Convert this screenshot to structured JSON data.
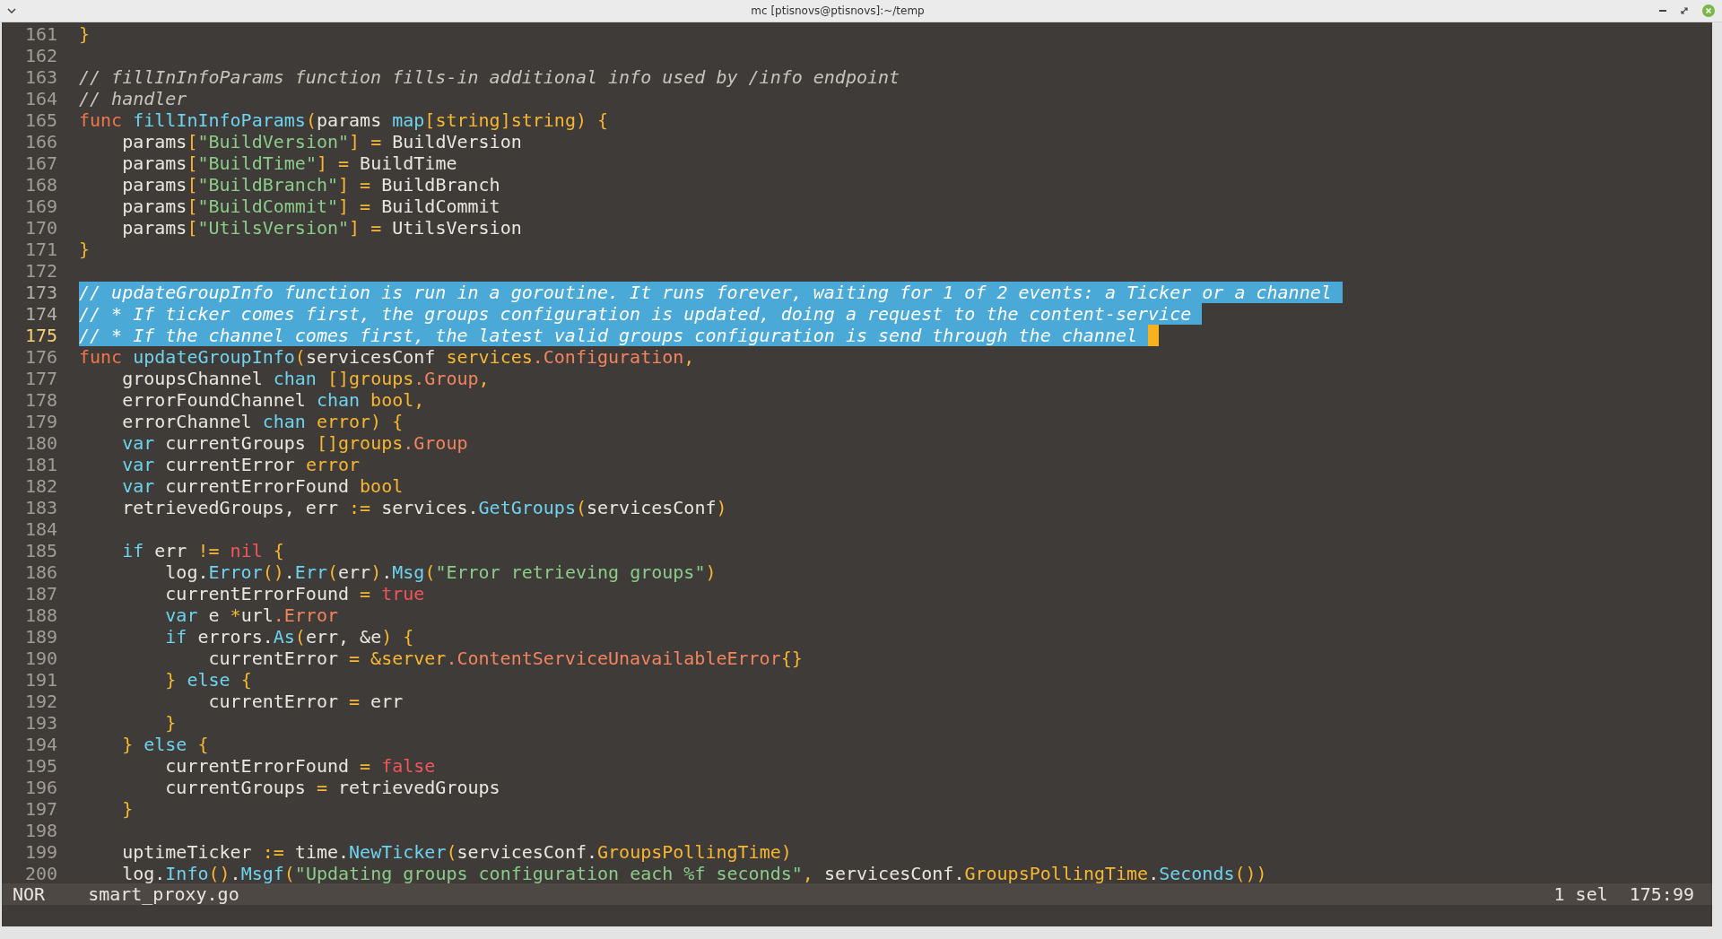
{
  "window": {
    "title": "mc [ptisnovs@ptisnovs]:~/temp"
  },
  "lines": [
    {
      "number": "161",
      "selected": false,
      "current": false,
      "tokens": [
        {
          "text": "}",
          "kind": "y"
        }
      ]
    },
    {
      "number": "162",
      "selected": false,
      "current": false
    },
    {
      "number": "163",
      "selected": false,
      "current": false,
      "tokens": [
        {
          "text": "// fillInInfoParams function fills-in additional info used by /info endpoint",
          "kind": "c"
        }
      ]
    },
    {
      "number": "164",
      "selected": false,
      "current": false,
      "tokens": [
        {
          "text": "// handler",
          "kind": "c"
        }
      ]
    },
    {
      "number": "165",
      "selected": false,
      "current": false,
      "tokens": [
        {
          "text": "func",
          "kind": "k"
        },
        {
          "text": " fillInInfoParams",
          "kind": "b"
        },
        {
          "text": "(",
          "kind": "y"
        },
        {
          "text": "params ",
          "kind": "p"
        },
        {
          "text": "map",
          "kind": "b"
        },
        {
          "text": "[string]string) {",
          "kind": "y"
        }
      ]
    },
    {
      "number": "166",
      "selected": false,
      "current": false,
      "tokens": [
        {
          "text": "    params",
          "kind": "p"
        },
        {
          "text": "[",
          "kind": "y"
        },
        {
          "text": "\"BuildVersion\"",
          "kind": "s"
        },
        {
          "text": "] = ",
          "kind": "y"
        },
        {
          "text": "BuildVersion",
          "kind": "p"
        }
      ]
    },
    {
      "number": "167",
      "selected": false,
      "current": false,
      "tokens": [
        {
          "text": "    params",
          "kind": "p"
        },
        {
          "text": "[",
          "kind": "y"
        },
        {
          "text": "\"BuildTime\"",
          "kind": "s"
        },
        {
          "text": "] = ",
          "kind": "y"
        },
        {
          "text": "BuildTime",
          "kind": "p"
        }
      ]
    },
    {
      "number": "168",
      "selected": false,
      "current": false,
      "tokens": [
        {
          "text": "    params",
          "kind": "p"
        },
        {
          "text": "[",
          "kind": "y"
        },
        {
          "text": "\"BuildBranch\"",
          "kind": "s"
        },
        {
          "text": "] = ",
          "kind": "y"
        },
        {
          "text": "BuildBranch",
          "kind": "p"
        }
      ]
    },
    {
      "number": "169",
      "selected": false,
      "current": false,
      "tokens": [
        {
          "text": "    params",
          "kind": "p"
        },
        {
          "text": "[",
          "kind": "y"
        },
        {
          "text": "\"BuildCommit\"",
          "kind": "s"
        },
        {
          "text": "] = ",
          "kind": "y"
        },
        {
          "text": "BuildCommit",
          "kind": "p"
        }
      ]
    },
    {
      "number": "170",
      "selected": false,
      "current": false,
      "tokens": [
        {
          "text": "    params",
          "kind": "p"
        },
        {
          "text": "[",
          "kind": "y"
        },
        {
          "text": "\"UtilsVersion\"",
          "kind": "s"
        },
        {
          "text": "] = ",
          "kind": "y"
        },
        {
          "text": "UtilsVersion",
          "kind": "p"
        }
      ]
    },
    {
      "number": "171",
      "selected": false,
      "current": false,
      "tokens": [
        {
          "text": "}",
          "kind": "y"
        }
      ]
    },
    {
      "number": "172",
      "selected": false,
      "current": false
    },
    {
      "number": "173",
      "selected": true,
      "current": false,
      "tokens": [
        {
          "text": "// updateGroupInfo function is run in a goroutine. It runs forever, waiting for 1 of 2 events: a Ticker or a channel",
          "kind": "c"
        }
      ]
    },
    {
      "number": "174",
      "selected": true,
      "current": false,
      "tokens": [
        {
          "text": "// * If ticker comes first, the groups configuration is updated, doing a request to the content-service",
          "kind": "c"
        }
      ]
    },
    {
      "number": "175",
      "selected": true,
      "current": true,
      "tokens": [
        {
          "text": "// * If the channel comes first, the latest valid groups configuration is send through the channel",
          "kind": "c"
        }
      ]
    },
    {
      "number": "176",
      "selected": false,
      "current": false,
      "tokens": [
        {
          "text": "func",
          "kind": "k"
        },
        {
          "text": " updateGroupInfo",
          "kind": "b"
        },
        {
          "text": "(",
          "kind": "y"
        },
        {
          "text": "servicesConf ",
          "kind": "p"
        },
        {
          "text": "services",
          "kind": "y"
        },
        {
          "text": ".Configuration",
          "kind": "o"
        },
        {
          "text": ",",
          "kind": "y"
        }
      ]
    },
    {
      "number": "177",
      "selected": false,
      "current": false,
      "tokens": [
        {
          "text": "    groupsChannel ",
          "kind": "p"
        },
        {
          "text": "chan",
          "kind": "b"
        },
        {
          "text": " []groups",
          "kind": "y"
        },
        {
          "text": ".Group",
          "kind": "o"
        },
        {
          "text": ",",
          "kind": "y"
        }
      ]
    },
    {
      "number": "178",
      "selected": false,
      "current": false,
      "tokens": [
        {
          "text": "    errorFoundChannel ",
          "kind": "p"
        },
        {
          "text": "chan",
          "kind": "b"
        },
        {
          "text": " bool,",
          "kind": "y"
        }
      ]
    },
    {
      "number": "179",
      "selected": false,
      "current": false,
      "tokens": [
        {
          "text": "    errorChannel ",
          "kind": "p"
        },
        {
          "text": "chan",
          "kind": "b"
        },
        {
          "text": " error) {",
          "kind": "y"
        }
      ]
    },
    {
      "number": "180",
      "selected": false,
      "current": false,
      "tokens": [
        {
          "text": "    var",
          "kind": "b"
        },
        {
          "text": " currentGroups ",
          "kind": "p"
        },
        {
          "text": "[]groups",
          "kind": "y"
        },
        {
          "text": ".Group",
          "kind": "o"
        }
      ]
    },
    {
      "number": "181",
      "selected": false,
      "current": false,
      "tokens": [
        {
          "text": "    var",
          "kind": "b"
        },
        {
          "text": " currentError ",
          "kind": "p"
        },
        {
          "text": "error",
          "kind": "y"
        }
      ]
    },
    {
      "number": "182",
      "selected": false,
      "current": false,
      "tokens": [
        {
          "text": "    var",
          "kind": "b"
        },
        {
          "text": " currentErrorFound ",
          "kind": "p"
        },
        {
          "text": "bool",
          "kind": "y"
        }
      ]
    },
    {
      "number": "183",
      "selected": false,
      "current": false,
      "tokens": [
        {
          "text": "    retrievedGroups, err ",
          "kind": "p"
        },
        {
          "text": ":=",
          "kind": "y"
        },
        {
          "text": " services.",
          "kind": "p"
        },
        {
          "text": "GetGroups",
          "kind": "b"
        },
        {
          "text": "(",
          "kind": "y"
        },
        {
          "text": "servicesConf",
          "kind": "p"
        },
        {
          "text": ")",
          "kind": "y"
        }
      ]
    },
    {
      "number": "184",
      "selected": false,
      "current": false
    },
    {
      "number": "185",
      "selected": false,
      "current": false,
      "tokens": [
        {
          "text": "    if",
          "kind": "b"
        },
        {
          "text": " err ",
          "kind": "p"
        },
        {
          "text": "!= ",
          "kind": "y"
        },
        {
          "text": "nil",
          "kind": "r"
        },
        {
          "text": " {",
          "kind": "y"
        }
      ]
    },
    {
      "number": "186",
      "selected": false,
      "current": false,
      "tokens": [
        {
          "text": "        log.",
          "kind": "p"
        },
        {
          "text": "Error",
          "kind": "b"
        },
        {
          "text": "()",
          "kind": "y"
        },
        {
          "text": ".",
          "kind": "p"
        },
        {
          "text": "Err",
          "kind": "b"
        },
        {
          "text": "(",
          "kind": "y"
        },
        {
          "text": "err",
          "kind": "p"
        },
        {
          "text": ")",
          "kind": "y"
        },
        {
          "text": ".",
          "kind": "p"
        },
        {
          "text": "Msg",
          "kind": "b"
        },
        {
          "text": "(",
          "kind": "y"
        },
        {
          "text": "\"Error retrieving groups\"",
          "kind": "s"
        },
        {
          "text": ")",
          "kind": "y"
        }
      ]
    },
    {
      "number": "187",
      "selected": false,
      "current": false,
      "tokens": [
        {
          "text": "        currentErrorFound ",
          "kind": "p"
        },
        {
          "text": "= ",
          "kind": "y"
        },
        {
          "text": "true",
          "kind": "r"
        }
      ]
    },
    {
      "number": "188",
      "selected": false,
      "current": false,
      "tokens": [
        {
          "text": "        var",
          "kind": "b"
        },
        {
          "text": " e ",
          "kind": "p"
        },
        {
          "text": "*",
          "kind": "y"
        },
        {
          "text": "url",
          "kind": "p"
        },
        {
          "text": ".Error",
          "kind": "o"
        }
      ]
    },
    {
      "number": "189",
      "selected": false,
      "current": false,
      "tokens": [
        {
          "text": "        if",
          "kind": "b"
        },
        {
          "text": " errors.",
          "kind": "p"
        },
        {
          "text": "As",
          "kind": "b"
        },
        {
          "text": "(",
          "kind": "y"
        },
        {
          "text": "err, &e",
          "kind": "p"
        },
        {
          "text": ") {",
          "kind": "y"
        }
      ]
    },
    {
      "number": "190",
      "selected": false,
      "current": false,
      "tokens": [
        {
          "text": "            currentError ",
          "kind": "p"
        },
        {
          "text": "= &server",
          "kind": "y"
        },
        {
          "text": ".ContentServiceUnavailableError",
          "kind": "o"
        },
        {
          "text": "{}",
          "kind": "y"
        }
      ]
    },
    {
      "number": "191",
      "selected": false,
      "current": false,
      "tokens": [
        {
          "text": "        } ",
          "kind": "y"
        },
        {
          "text": "else",
          "kind": "b"
        },
        {
          "text": " {",
          "kind": "y"
        }
      ]
    },
    {
      "number": "192",
      "selected": false,
      "current": false,
      "tokens": [
        {
          "text": "            currentError ",
          "kind": "p"
        },
        {
          "text": "=",
          "kind": "y"
        },
        {
          "text": " err",
          "kind": "p"
        }
      ]
    },
    {
      "number": "193",
      "selected": false,
      "current": false,
      "tokens": [
        {
          "text": "        }",
          "kind": "y"
        }
      ]
    },
    {
      "number": "194",
      "selected": false,
      "current": false,
      "tokens": [
        {
          "text": "    } ",
          "kind": "y"
        },
        {
          "text": "else",
          "kind": "b"
        },
        {
          "text": " {",
          "kind": "y"
        }
      ]
    },
    {
      "number": "195",
      "selected": false,
      "current": false,
      "tokens": [
        {
          "text": "        currentErrorFound ",
          "kind": "p"
        },
        {
          "text": "= ",
          "kind": "y"
        },
        {
          "text": "false",
          "kind": "r"
        }
      ]
    },
    {
      "number": "196",
      "selected": false,
      "current": false,
      "tokens": [
        {
          "text": "        currentGroups ",
          "kind": "p"
        },
        {
          "text": "=",
          "kind": "y"
        },
        {
          "text": " retrievedGroups",
          "kind": "p"
        }
      ]
    },
    {
      "number": "197",
      "selected": false,
      "current": false,
      "tokens": [
        {
          "text": "    }",
          "kind": "y"
        }
      ]
    },
    {
      "number": "198",
      "selected": false,
      "current": false
    },
    {
      "number": "199",
      "selected": false,
      "current": false,
      "tokens": [
        {
          "text": "    uptimeTicker ",
          "kind": "p"
        },
        {
          "text": ":=",
          "kind": "y"
        },
        {
          "text": " time.",
          "kind": "p"
        },
        {
          "text": "NewTicker",
          "kind": "b"
        },
        {
          "text": "(",
          "kind": "y"
        },
        {
          "text": "servicesConf.",
          "kind": "p"
        },
        {
          "text": "GroupsPollingTime",
          "kind": "y"
        },
        {
          "text": ")",
          "kind": "y"
        }
      ]
    },
    {
      "number": "200",
      "selected": false,
      "current": false,
      "tokens": [
        {
          "text": "    log.",
          "kind": "p"
        },
        {
          "text": "Info",
          "kind": "b"
        },
        {
          "text": "()",
          "kind": "y"
        },
        {
          "text": ".",
          "kind": "p"
        },
        {
          "text": "Msgf",
          "kind": "b"
        },
        {
          "text": "(",
          "kind": "y"
        },
        {
          "text": "\"Updating groups configuration each %f seconds\"",
          "kind": "s"
        },
        {
          "text": ", ",
          "kind": "y"
        },
        {
          "text": "servicesConf.",
          "kind": "p"
        },
        {
          "text": "GroupsPollingTime",
          "kind": "y"
        },
        {
          "text": ".",
          "kind": "p"
        },
        {
          "text": "Seconds",
          "kind": "b"
        },
        {
          "text": "())",
          "kind": "y"
        }
      ]
    }
  ],
  "status_bar": {
    "mode": "NOR",
    "file": "smart_proxy.go",
    "selections": "1 sel",
    "position": "175:99"
  }
}
